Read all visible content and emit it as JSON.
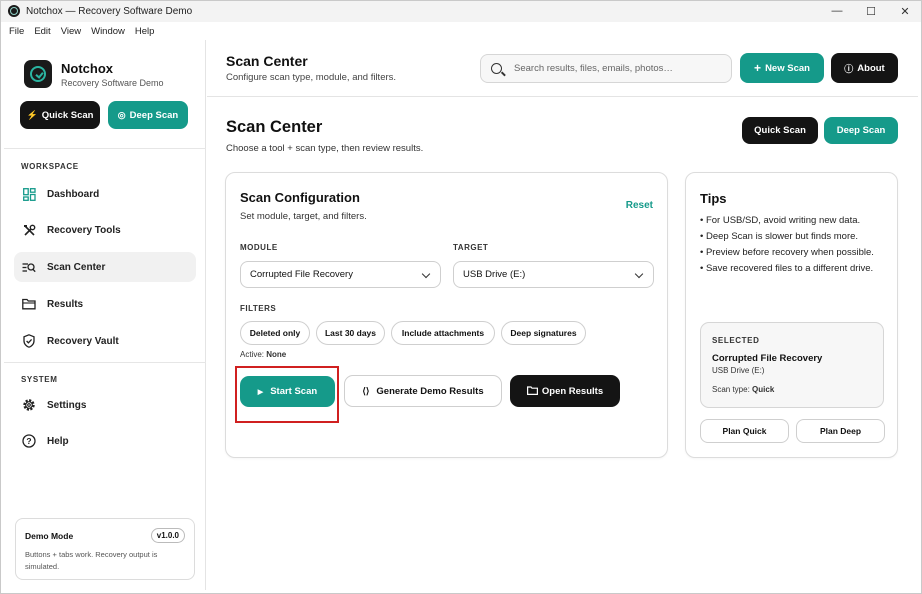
{
  "window": {
    "title": "Notchox — Recovery Software Demo",
    "controls": [
      "—",
      "☐",
      "✕"
    ]
  },
  "menubar": [
    "File",
    "Edit",
    "View",
    "Window",
    "Help"
  ],
  "brand": {
    "name": "Notchox",
    "subtitle": "Recovery Software Demo"
  },
  "sidebar": {
    "quick_scan": "Quick Scan",
    "deep_scan": "Deep Scan",
    "workspace_label": "WORKSPACE",
    "system_label": "SYSTEM",
    "items": [
      {
        "label": "Dashboard",
        "icon": "dashboard-icon"
      },
      {
        "label": "Recovery Tools",
        "icon": "tools-icon"
      },
      {
        "label": "Scan Center",
        "icon": "scan-icon"
      },
      {
        "label": "Results",
        "icon": "folder-icon"
      },
      {
        "label": "Recovery Vault",
        "icon": "shield-icon"
      },
      {
        "label": "Settings",
        "icon": "gear-icon"
      },
      {
        "label": "Help",
        "icon": "help-icon"
      }
    ],
    "demo": {
      "title": "Demo Mode",
      "version": "v1.0.0",
      "description": "Buttons + tabs work. Recovery output is simulated."
    }
  },
  "header": {
    "title": "Scan Center",
    "subtitle": "Configure scan type, module, and filters.",
    "search_placeholder": "Search results, files, emails, photos…",
    "new_scan": "New Scan",
    "about": "About"
  },
  "page": {
    "title": "Scan Center",
    "subtitle": "Choose a tool + scan type, then review results.",
    "quick_scan": "Quick Scan",
    "deep_scan": "Deep Scan"
  },
  "config": {
    "title": "Scan Configuration",
    "subtitle": "Set module, target, and filters.",
    "reset": "Reset",
    "module_label": "MODULE",
    "module_value": "Corrupted File Recovery",
    "target_label": "TARGET",
    "target_value": "USB Drive (E:)",
    "filters_label": "FILTERS",
    "filters": [
      "Deleted only",
      "Last 30 days",
      "Include attachments",
      "Deep signatures"
    ],
    "active_prefix": "Active:",
    "active_value": "None",
    "start_scan": "Start Scan",
    "generate": "Generate Demo Results",
    "open_results": "Open Results"
  },
  "tips": {
    "title": "Tips",
    "items": [
      "• For USB/SD, avoid writing new data.",
      "• Deep Scan is slower but finds more.",
      "• Preview before recovery when possible.",
      "• Save recovered files to a different drive."
    ],
    "selected_label": "SELECTED",
    "selected_name": "Corrupted File Recovery",
    "selected_target": "USB Drive (E:)",
    "scan_type_prefix": "Scan type:",
    "scan_type_value": "Quick",
    "plan_quick": "Plan Quick",
    "plan_deep": "Plan Deep"
  },
  "colors": {
    "accent": "#159a8a",
    "dark": "#141414",
    "highlight": "#d02020"
  }
}
